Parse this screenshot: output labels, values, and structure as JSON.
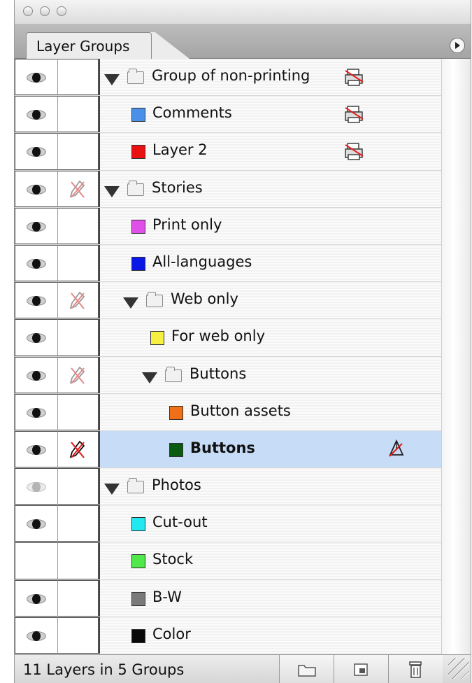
{
  "window": {
    "tab_title": "Layer Groups"
  },
  "layers": [
    {
      "label": "Group of non-printing",
      "type": "group",
      "depth": 0,
      "color": null,
      "eye": "visible",
      "lock": "none",
      "non_printing": true,
      "striped": true
    },
    {
      "label": "Comments",
      "type": "layer",
      "depth": 0,
      "color": "#4a90e8",
      "eye": "visible",
      "lock": "none",
      "non_printing": true,
      "striped": true
    },
    {
      "label": "Layer 2",
      "type": "layer",
      "depth": 0,
      "color": "#e81010",
      "eye": "visible",
      "lock": "none",
      "non_printing": true,
      "striped": true
    },
    {
      "label": "Stories",
      "type": "group",
      "depth": 0,
      "color": null,
      "eye": "visible",
      "lock": "partial",
      "non_printing": false,
      "striped": true
    },
    {
      "label": "Print only",
      "type": "layer",
      "depth": 0,
      "color": "#e050e8",
      "eye": "visible",
      "lock": "none",
      "non_printing": false,
      "striped": true
    },
    {
      "label": "All-languages",
      "type": "layer",
      "depth": 0,
      "color": "#0a18e6",
      "eye": "visible",
      "lock": "none",
      "non_printing": false,
      "striped": true
    },
    {
      "label": "Web only",
      "type": "group",
      "depth": 1,
      "color": null,
      "eye": "visible",
      "lock": "partial",
      "non_printing": false,
      "striped": true
    },
    {
      "label": "For web only",
      "type": "layer",
      "depth": 1,
      "color": "#f6f040",
      "eye": "visible",
      "lock": "none",
      "non_printing": false,
      "striped": true
    },
    {
      "label": "Buttons",
      "type": "group",
      "depth": 2,
      "color": null,
      "eye": "visible",
      "lock": "partial",
      "non_printing": false,
      "striped": true
    },
    {
      "label": "Button assets",
      "type": "layer",
      "depth": 2,
      "color": "#f0701a",
      "eye": "visible",
      "lock": "none",
      "non_printing": false,
      "striped": true
    },
    {
      "label": "Buttons",
      "type": "layer",
      "depth": 2,
      "color": "#0a5a12",
      "eye": "visible",
      "lock": "locked",
      "non_printing": false,
      "selected": true,
      "striped": false
    },
    {
      "label": "Photos",
      "type": "group",
      "depth": 0,
      "color": null,
      "eye": "dim",
      "lock": "none",
      "non_printing": false,
      "striped": true
    },
    {
      "label": "Cut-out",
      "type": "layer",
      "depth": 0,
      "color": "#22e8f0",
      "eye": "visible",
      "lock": "none",
      "non_printing": false,
      "striped": true
    },
    {
      "label": "Stock",
      "type": "layer",
      "depth": 0,
      "color": "#50e84a",
      "eye": "hidden",
      "lock": "none",
      "non_printing": false,
      "striped": true
    },
    {
      "label": "B-W",
      "type": "layer",
      "depth": 0,
      "color": "#7a7a7a",
      "eye": "visible",
      "lock": "none",
      "non_printing": false,
      "striped": true
    },
    {
      "label": "Color",
      "type": "layer",
      "depth": 0,
      "color": "#080808",
      "eye": "visible",
      "lock": "none",
      "non_printing": false,
      "striped": true
    }
  ],
  "footer": {
    "status": "11 Layers in 5 Groups",
    "buttons": [
      "new-group",
      "new-layer",
      "delete-layer"
    ]
  }
}
